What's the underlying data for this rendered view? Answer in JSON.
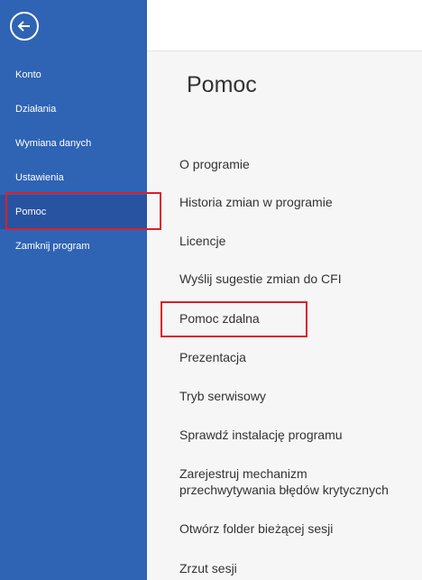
{
  "sidebar": {
    "back_icon": "arrow-left-circle-icon",
    "items": [
      {
        "label": "Konto"
      },
      {
        "label": "Działania"
      },
      {
        "label": "Wymiana danych"
      },
      {
        "label": "Ustawienia"
      },
      {
        "label": "Pomoc",
        "active": true
      },
      {
        "label": "Zamknij program"
      }
    ]
  },
  "main": {
    "title": "Pomoc",
    "items": [
      {
        "label": "O programie"
      },
      {
        "label": "Historia zmian w programie"
      },
      {
        "label": "Licencje"
      },
      {
        "label": "Wyślij sugestie zmian do CFI"
      },
      {
        "label": "Pomoc zdalna"
      },
      {
        "label": "Prezentacja"
      },
      {
        "label": "Tryb serwisowy"
      },
      {
        "label": "Sprawdź instalację programu"
      },
      {
        "label_line1": "Zarejestruj mechanizm",
        "label_line2": "przechwytywania błędów krytycznych"
      },
      {
        "label": "Otwórz folder bieżącej sesji"
      },
      {
        "label": "Zrzut sesji"
      }
    ]
  },
  "colors": {
    "sidebar_bg": "#2f63b4",
    "sidebar_active_bg": "#2753a0",
    "highlight_border": "#d9202b",
    "content_bg": "#f6f6f6",
    "text": "#333333"
  }
}
